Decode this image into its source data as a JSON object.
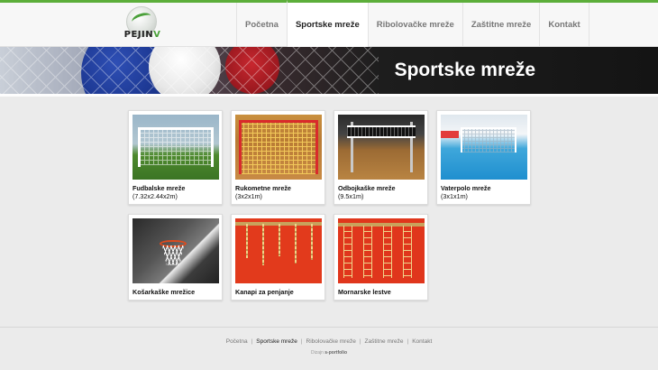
{
  "brand": {
    "logo_text_a": "PEJIN",
    "logo_text_b": "V"
  },
  "nav": {
    "items": [
      {
        "label": "Početna"
      },
      {
        "label": "Sportske mreže",
        "active": true
      },
      {
        "label": "Ribolovačke mreže"
      },
      {
        "label": "Zaštitne mreže"
      },
      {
        "label": "Kontakt"
      }
    ]
  },
  "banner": {
    "title": "Sportske mreže"
  },
  "products": [
    {
      "name": "Fudbalske mreže",
      "dims": "(7.32x2.44x2m)"
    },
    {
      "name": "Rukometne mreže",
      "dims": "(3x2x1m)"
    },
    {
      "name": "Odbojkaške mreže",
      "dims": "(9.5x1m)"
    },
    {
      "name": "Vaterpolo mreže",
      "dims": "(3x1x1m)"
    },
    {
      "name": "Košarkaške mrežice"
    },
    {
      "name": "Kanapi za penjanje"
    },
    {
      "name": "Mornarske lestve"
    }
  ],
  "footer": {
    "links": [
      {
        "label": "Početna"
      },
      {
        "label": "Sportske mreže",
        "active": true
      },
      {
        "label": "Ribolovačke mreže"
      },
      {
        "label": "Zaštitne mreže"
      },
      {
        "label": "Kontakt"
      }
    ],
    "separator": "|",
    "credit_prefix": "Dizajn",
    "credit_name": "s-portfolio"
  },
  "colors": {
    "accent": "#5cae3a",
    "background": "#ebebeb"
  }
}
